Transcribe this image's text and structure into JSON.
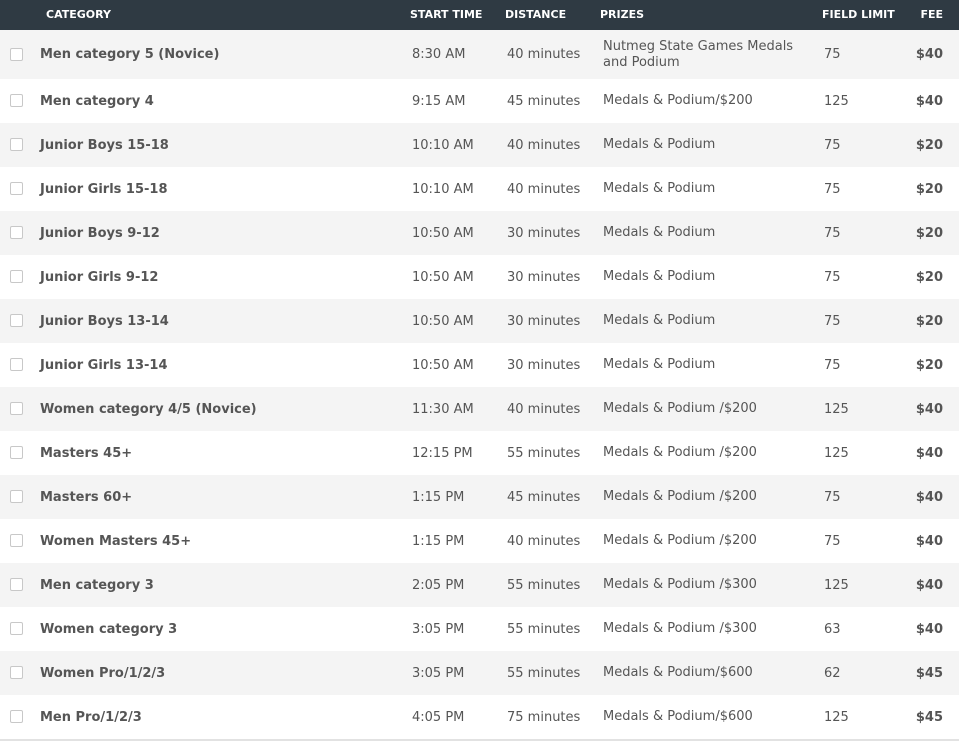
{
  "columns": {
    "category": "CATEGORY",
    "start_time": "START TIME",
    "distance": "DISTANCE",
    "prizes": "PRIZES",
    "field_limit": "FIELD LIMIT",
    "fee": "FEE"
  },
  "rows": [
    {
      "category": "Men category 5 (Novice)",
      "start_time": "8:30 AM",
      "distance": "40 minutes",
      "prizes": "Nutmeg State Games Medals and Podium",
      "field_limit": "75",
      "fee": "$40"
    },
    {
      "category": "Men category 4",
      "start_time": "9:15 AM",
      "distance": "45 minutes",
      "prizes": "Medals & Podium/$200",
      "field_limit": "125",
      "fee": "$40"
    },
    {
      "category": "Junior Boys 15-18",
      "start_time": "10:10 AM",
      "distance": "40 minutes",
      "prizes": "Medals & Podium",
      "field_limit": "75",
      "fee": "$20"
    },
    {
      "category": "Junior Girls 15-18",
      "start_time": "10:10 AM",
      "distance": "40 minutes",
      "prizes": "Medals & Podium",
      "field_limit": "75",
      "fee": "$20"
    },
    {
      "category": "Junior Boys 9-12",
      "start_time": "10:50 AM",
      "distance": "30 minutes",
      "prizes": "Medals & Podium",
      "field_limit": "75",
      "fee": "$20"
    },
    {
      "category": "Junior Girls 9-12",
      "start_time": "10:50 AM",
      "distance": "30 minutes",
      "prizes": "Medals & Podium",
      "field_limit": "75",
      "fee": "$20"
    },
    {
      "category": "Junior Boys 13-14",
      "start_time": "10:50 AM",
      "distance": "30 minutes",
      "prizes": "Medals & Podium",
      "field_limit": "75",
      "fee": "$20"
    },
    {
      "category": "Junior Girls 13-14",
      "start_time": "10:50 AM",
      "distance": "30 minutes",
      "prizes": "Medals & Podium",
      "field_limit": "75",
      "fee": "$20"
    },
    {
      "category": "Women category 4/5 (Novice)",
      "start_time": "11:30 AM",
      "distance": "40 minutes",
      "prizes": "Medals & Podium /$200",
      "field_limit": "125",
      "fee": "$40"
    },
    {
      "category": "Masters 45+",
      "start_time": "12:15 PM",
      "distance": "55 minutes",
      "prizes": "Medals & Podium /$200",
      "field_limit": "125",
      "fee": "$40"
    },
    {
      "category": "Masters 60+",
      "start_time": "1:15 PM",
      "distance": "45 minutes",
      "prizes": "Medals & Podium /$200",
      "field_limit": "75",
      "fee": "$40"
    },
    {
      "category": "Women Masters 45+",
      "start_time": "1:15 PM",
      "distance": "40 minutes",
      "prizes": "Medals & Podium /$200",
      "field_limit": "75",
      "fee": "$40"
    },
    {
      "category": "Men category 3",
      "start_time": "2:05 PM",
      "distance": "55 minutes",
      "prizes": "Medals & Podium /$300",
      "field_limit": "125",
      "fee": "$40"
    },
    {
      "category": "Women category 3",
      "start_time": "3:05 PM",
      "distance": "55 minutes",
      "prizes": "Medals & Podium /$300",
      "field_limit": "63",
      "fee": "$40"
    },
    {
      "category": "Women Pro/1/2/3",
      "start_time": "3:05 PM",
      "distance": "55 minutes",
      "prizes": "Medals & Podium/$600",
      "field_limit": "62",
      "fee": "$45"
    },
    {
      "category": "Men Pro/1/2/3",
      "start_time": "4:05 PM",
      "distance": "75 minutes",
      "prizes": "Medals & Podium/$600",
      "field_limit": "125",
      "fee": "$45"
    }
  ]
}
